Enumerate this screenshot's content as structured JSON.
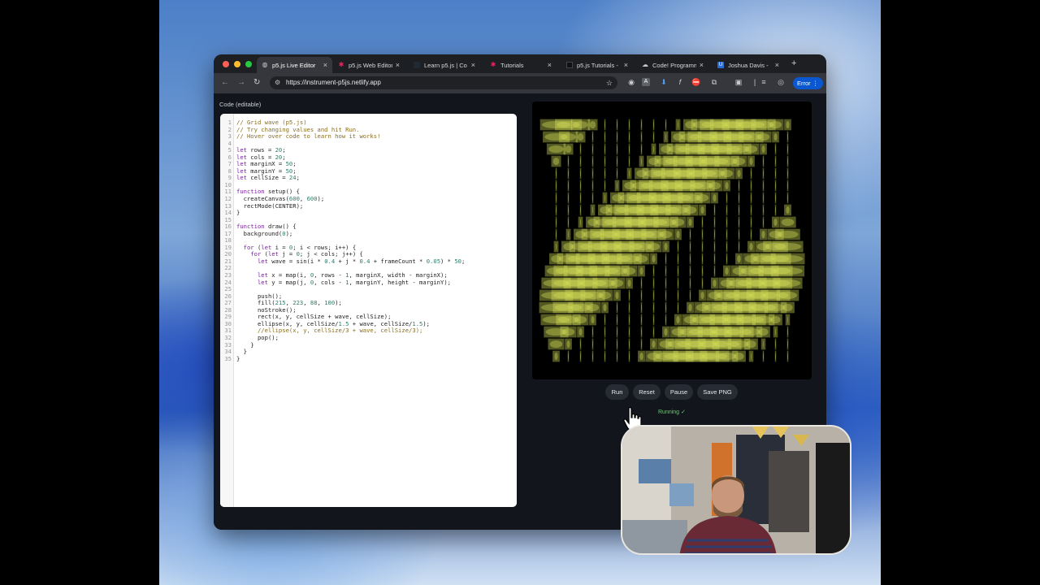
{
  "browser": {
    "tabs": [
      {
        "title": "p5.js Live Editor",
        "icon": "globe-icon",
        "active": true
      },
      {
        "title": "p5.js Web Editor",
        "icon": "p5-star-icon"
      },
      {
        "title": "Learn p5.js | Co",
        "icon": "codecademy-icon"
      },
      {
        "title": "Tutorials",
        "icon": "p5-star-icon"
      },
      {
        "title": "p5.js Tutorials -",
        "icon": "p5-icon"
      },
      {
        "title": "Code! Programm",
        "icon": "cloud-icon"
      },
      {
        "title": "Joshua Davis -",
        "icon": "u-icon"
      }
    ],
    "new_tab": "+",
    "url": "https://instrument-p5js.netlify.app",
    "error_label": "Error"
  },
  "app": {
    "code_label": "Code (editable)",
    "code_lines": [
      "// Grid wave (p5.js)",
      "// Try changing values and hit Run.",
      "// Hover over code to learn how it works!",
      "",
      "let rows = 20;",
      "let cols = 20;",
      "let marginX = 50;",
      "let marginY = 50;",
      "let cellSize = 24;",
      "",
      "function setup() {",
      "  createCanvas(600, 600);",
      "  rectMode(CENTER);",
      "}",
      "",
      "function draw() {",
      "  background(0);",
      "",
      "  for (let i = 0; i < rows; i++) {",
      "    for (let j = 0; j < cols; j++) {",
      "      let wave = sin(i * 0.4 + j * 0.4 + frameCount * 0.05) * 50;",
      "",
      "      let x = map(i, 0, rows - 1, marginX, width - marginX);",
      "      let y = map(j, 0, cols - 1, marginY, height - marginY);",
      "",
      "      push();",
      "      fill(215, 223, 88, 100);",
      "      noStroke();",
      "      rect(x, y, cellSize + wave, cellSize);",
      "      ellipse(x, y, cellSize/1.5 + wave, cellSize/1.5);",
      "      //ellipse(x, y, cellSize/3 + wave, cellSize/3);",
      "      pop();",
      "    }",
      "  }",
      "}"
    ],
    "buttons": {
      "run": "Run",
      "reset": "Reset",
      "pause": "Pause",
      "save": "Save PNG"
    },
    "status": "Running ✓",
    "fill_color": "#d7df58"
  }
}
